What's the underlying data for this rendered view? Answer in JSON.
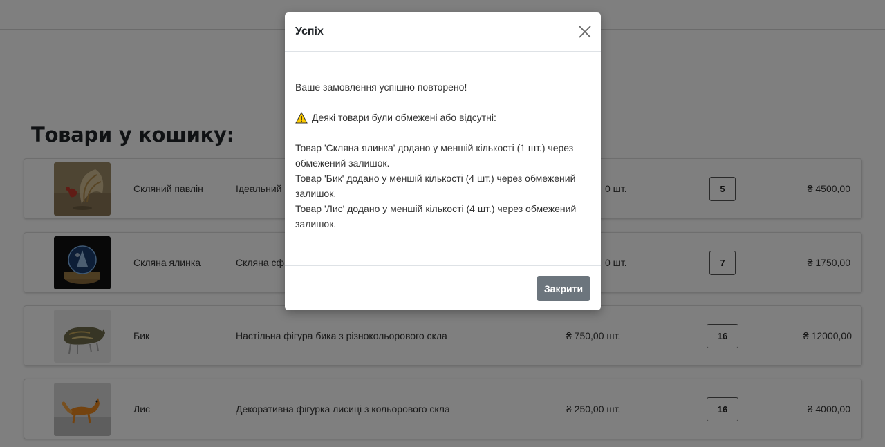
{
  "cart": {
    "title": "Товари у кошику:",
    "items": [
      {
        "name": "Скляний павлін",
        "description": "Ідеальний",
        "price": "0 шт.",
        "quantity": "5",
        "total": "₴ 4500,00"
      },
      {
        "name": "Скляна ялинка",
        "description": "Скляна сф",
        "price": "0 шт.",
        "quantity": "7",
        "total": "₴ 1750,00"
      },
      {
        "name": "Бик",
        "description": "Настільна фігура бика з різнокольорового скла",
        "price": "₴ 750,00 шт.",
        "quantity": "16",
        "total": "₴ 12000,00"
      },
      {
        "name": "Лис",
        "description": "Декоративна фігурка лисиці з кольорового скла",
        "price": "₴ 250,00 шт.",
        "quantity": "16",
        "total": "₴ 4000,00"
      }
    ]
  },
  "modal": {
    "title": "Успіх",
    "message": "Ваше замовлення успішно повторено!",
    "warning": "Деякі товари були обмежені або відсутні:",
    "details": [
      "Товар 'Скляна ялинка' додано у меншій кількості (1 шт.) через обмежений залишок.",
      "Товар 'Бик' додано у меншій кількості (4 шт.) через обмежений залишок.",
      "Товар 'Лис' додано у меншій кількості (4 шт.) через обмежений залишок."
    ],
    "close_button": "Закрити",
    "close_icon": "close-icon",
    "warning_icon": "warning-icon"
  },
  "colors": {
    "overlay": "#000000",
    "button_secondary": "#6c757d",
    "warning_yellow": "#ffcc00"
  }
}
